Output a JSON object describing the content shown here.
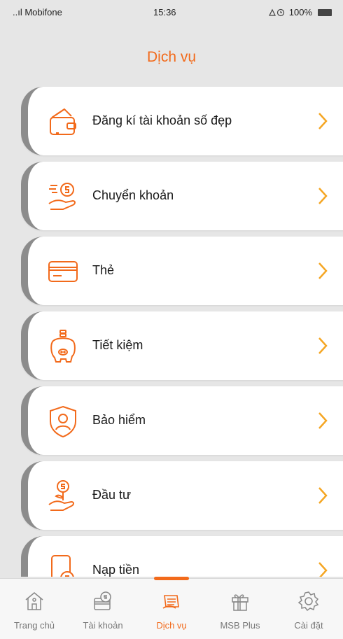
{
  "status_bar": {
    "carrier": "..ıl Mobifone",
    "time": "15:36",
    "battery": "100%"
  },
  "header": {
    "title": "Dịch vụ"
  },
  "services": [
    {
      "label": "Đăng kí tài khoản số đẹp",
      "icon": "wallet-icon"
    },
    {
      "label": "Chuyển khoản",
      "icon": "money-transfer-icon"
    },
    {
      "label": "Thẻ",
      "icon": "card-icon"
    },
    {
      "label": "Tiết kiệm",
      "icon": "piggy-bank-icon"
    },
    {
      "label": "Bảo hiểm",
      "icon": "insurance-shield-icon"
    },
    {
      "label": "Đầu tư",
      "icon": "investment-icon"
    },
    {
      "label": "Nạp tiền",
      "icon": "top-up-phone-icon"
    }
  ],
  "tabs": [
    {
      "label": "Trang chủ",
      "icon": "home-icon"
    },
    {
      "label": "Tài khoản",
      "icon": "account-icon"
    },
    {
      "label": "Dịch vụ",
      "icon": "services-icon",
      "active": true
    },
    {
      "label": "MSB Plus",
      "icon": "gift-icon"
    },
    {
      "label": "Cài đặt",
      "icon": "settings-gear-icon"
    }
  ],
  "colors": {
    "accent": "#f26a1b",
    "background": "#e6e6e6",
    "card": "#ffffff",
    "tab_inactive": "#777777"
  }
}
